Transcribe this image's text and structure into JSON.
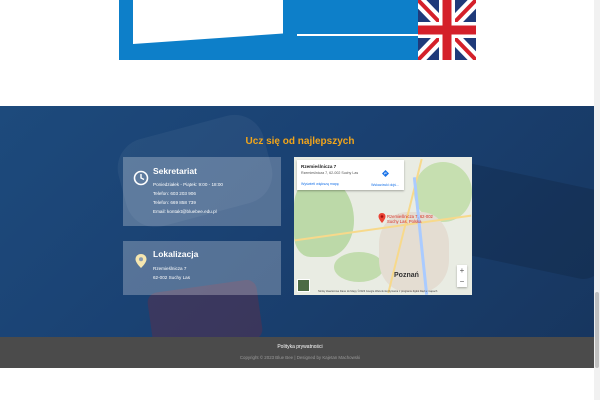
{
  "section": {
    "title": "Ucz się od najlepszych"
  },
  "hours_card": {
    "title": "Sekretariat",
    "lines": [
      "Poniedziałek - Piątek: 9:00 - 18:00",
      "Telefon: 603 203 906",
      "Telefon: 669 858 739",
      "Email: kontakt@bluebee.edu.pl"
    ],
    "icon": "clock-icon"
  },
  "location_card": {
    "title": "Lokalizacja",
    "lines": [
      "Rzemieślnicza 7",
      "62-002 Suchy Las"
    ],
    "icon": "map-pin-icon"
  },
  "map": {
    "place_title": "Rzemieślnicza 7",
    "place_address": "Rzemieślnicza 7, 62-002 Suchy Las",
    "directions_label": "Wskazówki dojś...",
    "larger_map_link": "Wyświetl większą mapę",
    "pin_label_line1": "Rzemieślnicza 7, 62-002",
    "pin_label_line2": "Suchy Las, Polska",
    "city": "Poznań",
    "zoom_in": "+",
    "zoom_out": "−",
    "attribution": "Skróty klawiszowe   Dane do Mapy ©2023 Google   Warunki korzystania z programu   Zgłoś błąd w mapach"
  },
  "footer": {
    "privacy_link": "Polityka prywatności",
    "copyright": "Copyright © 2023 Blue Bee | Designed by Kajetan Machowski"
  },
  "colors": {
    "accent": "#f2a51a",
    "section_bg": "#1d4a7c",
    "footer_bg": "#4b4b4b",
    "banner": "#0d7fc9"
  }
}
